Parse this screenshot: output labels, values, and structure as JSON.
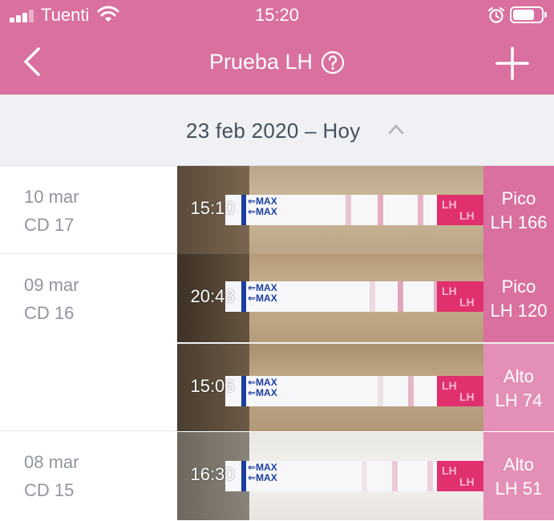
{
  "status_bar": {
    "carrier": "Tuenti",
    "time": "15:20",
    "icons": [
      "signal-icon",
      "wifi-icon",
      "alarm-icon",
      "battery-icon"
    ]
  },
  "nav": {
    "title": "Prueba LH",
    "back_icon": "chevron-left-icon",
    "help_icon": "question-circle-icon",
    "add_icon": "plus-icon"
  },
  "range": {
    "label": "23 feb 2020 – Hoy",
    "caret_icon": "chevron-up-icon"
  },
  "colors": {
    "brand": "#d9709f",
    "result_peak": "#d9709f",
    "result_high": "#e48fb7",
    "range_bg": "#eff1f4"
  },
  "days": [
    {
      "date": "10 mar",
      "cd": "CD 17",
      "entries": [
        {
          "time": "15:10",
          "level": "Pico",
          "value": "LH 166"
        }
      ]
    },
    {
      "date": "09 mar",
      "cd": "CD 16",
      "entries": [
        {
          "time": "20:48",
          "level": "Pico",
          "value": "LH 120"
        },
        {
          "time": "15:06",
          "level": "Alto",
          "value": "LH 74"
        }
      ]
    },
    {
      "date": "08 mar",
      "cd": "CD 15",
      "entries": [
        {
          "time": "16:30",
          "level": "Alto",
          "value": "LH 51"
        }
      ]
    }
  ]
}
